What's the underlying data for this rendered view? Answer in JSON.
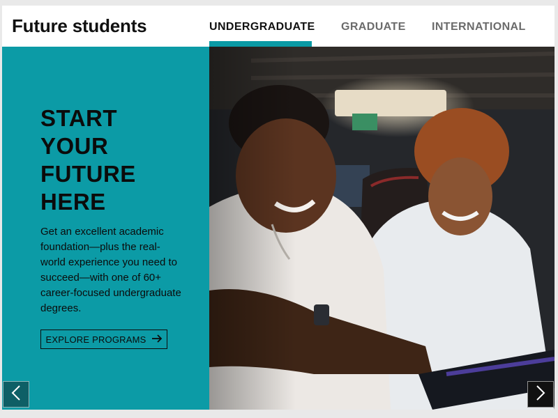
{
  "header": {
    "title": "Future students",
    "tabs": [
      {
        "label": "UNDERGRADUATE",
        "active": true
      },
      {
        "label": "GRADUATE",
        "active": false
      },
      {
        "label": "INTERNATIONAL",
        "active": false
      }
    ]
  },
  "hero": {
    "headline_lines": [
      "START",
      "YOUR",
      "FUTURE",
      "HERE"
    ],
    "body": "Get an excellent academic foundation—plus the real-world experience you need to succeed—with one of 60+ career-focused undergraduate degrees.",
    "cta_label": "EXPLORE PROGRAMS",
    "cta_icon": "arrow-right-icon",
    "image": "photo-two-students-smiling-at-computer"
  },
  "carousel": {
    "prev_icon": "chevron-left-icon",
    "next_icon": "chevron-right-icon"
  },
  "colors": {
    "accent": "#0c9ba6",
    "text": "#0b0b0b",
    "tab_inactive": "#6b6b6b"
  }
}
